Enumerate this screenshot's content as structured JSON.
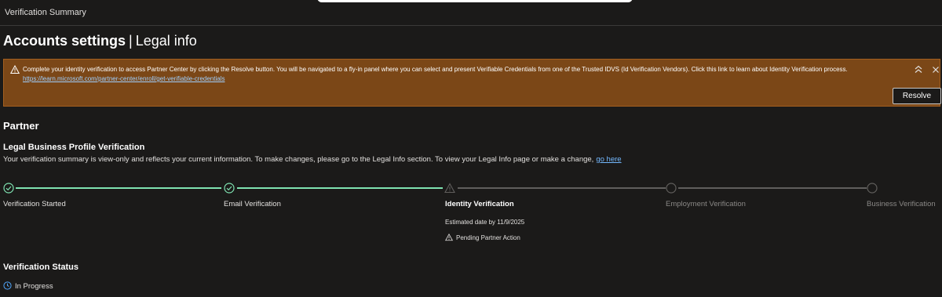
{
  "header": {
    "title": "Verification Summary"
  },
  "page": {
    "title_main": "Accounts settings",
    "title_separator": "|",
    "title_sub": "Legal info"
  },
  "banner": {
    "message": "Complete your identity verification to access Partner Center by clicking the Resolve button. You will be navigated to a fly-in panel where you can select and present Verifiable Credentials from one of the Trusted IDVS (Id Verification Vendors). Click this link to learn about Identity Verification process.",
    "link": "https://learn.microsoft.com/partner-center/enroll/get-verifiable-credentials",
    "resolve_label": "Resolve",
    "colors": {
      "background": "#7b4717",
      "border": "#a35f1f"
    }
  },
  "partner": {
    "heading": "Partner",
    "profile_heading": "Legal Business Profile Verification",
    "description": "Your verification summary is view-only and reflects your current information. To make changes, please go to the Legal Info section. To view your Legal Info page or make a change,",
    "link_label": "go here"
  },
  "steps": [
    {
      "label": "Verification Started",
      "state": "completed",
      "icon": "check-circle-icon"
    },
    {
      "label": "Email Verification",
      "state": "completed",
      "icon": "check-circle-icon"
    },
    {
      "label": "Identity Verification",
      "state": "current",
      "icon": "warning-icon"
    },
    {
      "label": "Employment Verification",
      "state": "not-started",
      "icon": "empty-circle-icon"
    },
    {
      "label": "Business Verification",
      "state": "not-started",
      "icon": "empty-circle-icon"
    }
  ],
  "current_step": {
    "estimated_date": "Estimated date by 11/9/2025",
    "pending": "Pending Partner Action"
  },
  "status": {
    "heading": "Verification Status",
    "value": "In Progress"
  },
  "colors": {
    "accent_done": "#7fe2b1",
    "link": "#74b9ff",
    "status_icon": "#4fa3f7"
  }
}
